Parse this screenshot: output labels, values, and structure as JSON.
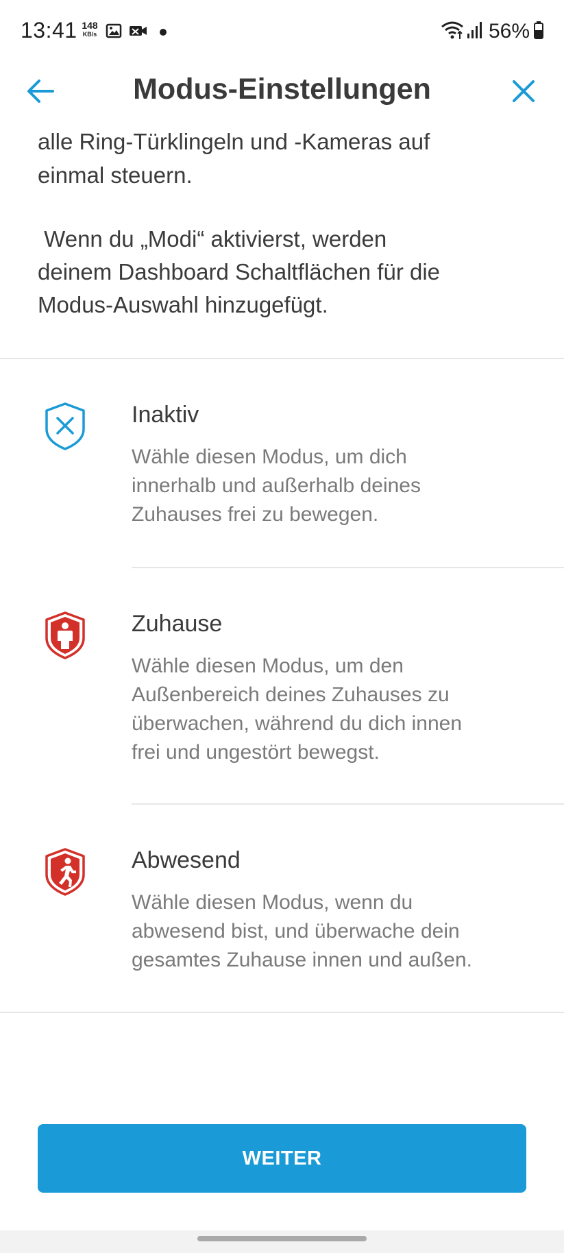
{
  "status_bar": {
    "time": "13:41",
    "net_speed_value": "148",
    "net_speed_unit": "KB/s",
    "battery": "56%",
    "icons": [
      "gallery-icon",
      "camera-off-icon",
      "notification-dot",
      "wifi-icon",
      "signal-icon",
      "battery-icon"
    ]
  },
  "header": {
    "title": "Modus-Einstellungen",
    "back_icon": "arrow-left-icon",
    "close_icon": "close-icon",
    "accent_color": "#1a9ad6"
  },
  "intro": {
    "paragraph1_lines": [
      "alle Ring-Türklingeln und -Kameras auf",
      "einmal steuern."
    ],
    "paragraph2_lines": [
      " Wenn du „Modi“ aktivierst, werden",
      "deinem Dashboard Schaltflächen für die",
      "Modus-Auswahl hinzugefügt."
    ]
  },
  "modes": [
    {
      "title": "Inaktiv",
      "icon": "shield-x-icon",
      "icon_color": "#1a9ad6",
      "desc_lines": [
        "Wähle diesen Modus, um dich",
        "innerhalb und außerhalb deines",
        "Zuhauses frei zu bewegen."
      ]
    },
    {
      "title": "Zuhause",
      "icon": "shield-person-icon",
      "icon_color": "#d3302a",
      "desc_lines": [
        "Wähle diesen Modus, um den",
        "Außenbereich deines Zuhauses zu",
        "überwachen, während du dich innen",
        "frei und ungestört bewegst."
      ]
    },
    {
      "title": "Abwesend",
      "icon": "shield-running-icon",
      "icon_color": "#d3302a",
      "desc_lines": [
        "Wähle diesen Modus, wenn du",
        "abwesend bist, und überwache dein",
        "gesamtes Zuhause innen und außen."
      ]
    }
  ],
  "primary_button": {
    "label": "WEITER",
    "color": "#1a9ad6"
  }
}
